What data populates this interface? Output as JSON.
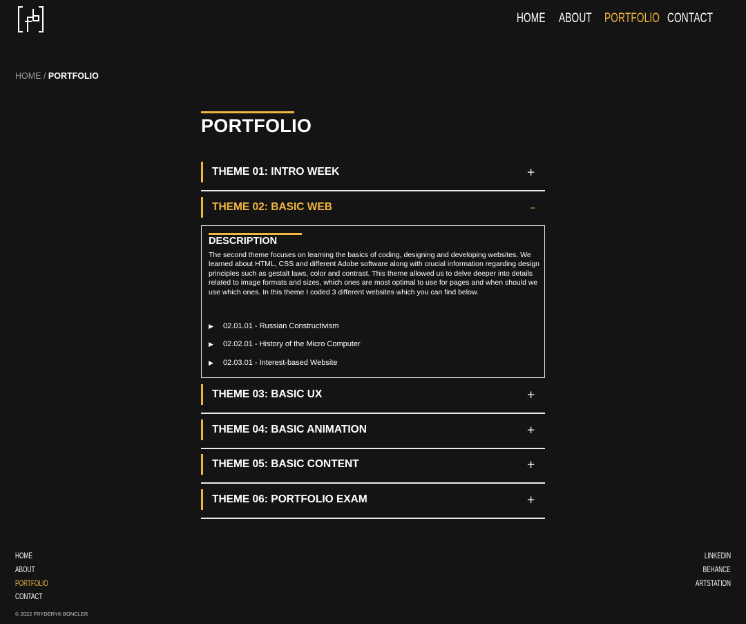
{
  "header": {
    "logo_text": "FB",
    "nav": [
      {
        "label": "HOME"
      },
      {
        "label": "ABOUT"
      },
      {
        "label": "PORTFOLIO"
      },
      {
        "label": "CONTACT"
      }
    ],
    "active_nav": "PORTFOLIO"
  },
  "breadcrumb": {
    "home": "HOME",
    "separator": " / ",
    "current": "PORTFOLIO"
  },
  "main": {
    "title": "PORTFOLIO",
    "accordion": [
      {
        "label": "THEME 01: INTRO WEEK",
        "toggle": "+",
        "open": false
      },
      {
        "label": "THEME 02: BASIC WEB",
        "toggle": "–",
        "open": true
      },
      {
        "label": "THEME 03: BASIC UX",
        "toggle": "+",
        "open": false
      },
      {
        "label": "THEME 04: BASIC ANIMATION",
        "toggle": "+",
        "open": false
      },
      {
        "label": "THEME 05: BASIC CONTENT",
        "toggle": "+",
        "open": false
      },
      {
        "label": "THEME 06: PORTFOLIO EXAM",
        "toggle": "+",
        "open": false
      }
    ],
    "open_panel": {
      "heading": "DESCRIPTION",
      "text": "The second theme focuses on learning the basics of coding, designing and developing websites. We learned about HTML, CSS and different Adobe software along with crucial information regarding design principles such as gestalt laws, color and contrast. This theme allowed us to delve deeper into details related to image formats and sizes, which ones are most optimal to use for pages and when should we use which ones. In this theme I coded 3 different websites which you can find below.",
      "items": [
        {
          "icon": "play-triangle-icon",
          "glyph": "▶",
          "label": "02.01.01 - Russian Constructivism"
        },
        {
          "icon": "play-triangle-icon",
          "glyph": "▶",
          "label": "02.02.01 - History of the Micro Computer"
        },
        {
          "icon": "play-triangle-icon",
          "glyph": "▶",
          "label": "02.03.01 - Interest-based Website"
        }
      ]
    }
  },
  "footer": {
    "nav": [
      {
        "label": "HOME"
      },
      {
        "label": "ABOUT"
      },
      {
        "label": "PORTFOLIO"
      },
      {
        "label": "CONTACT"
      }
    ],
    "social": [
      {
        "label": "LINKEDIN"
      },
      {
        "label": "BEHANCE"
      },
      {
        "label": "ARTSTATION"
      }
    ],
    "copyright": "© 2022 FRYDERYK BONCLER"
  },
  "colors": {
    "background": "#141414",
    "accent": "#f1b63e",
    "text": "#ffffff",
    "muted": "#9a9a9a"
  }
}
